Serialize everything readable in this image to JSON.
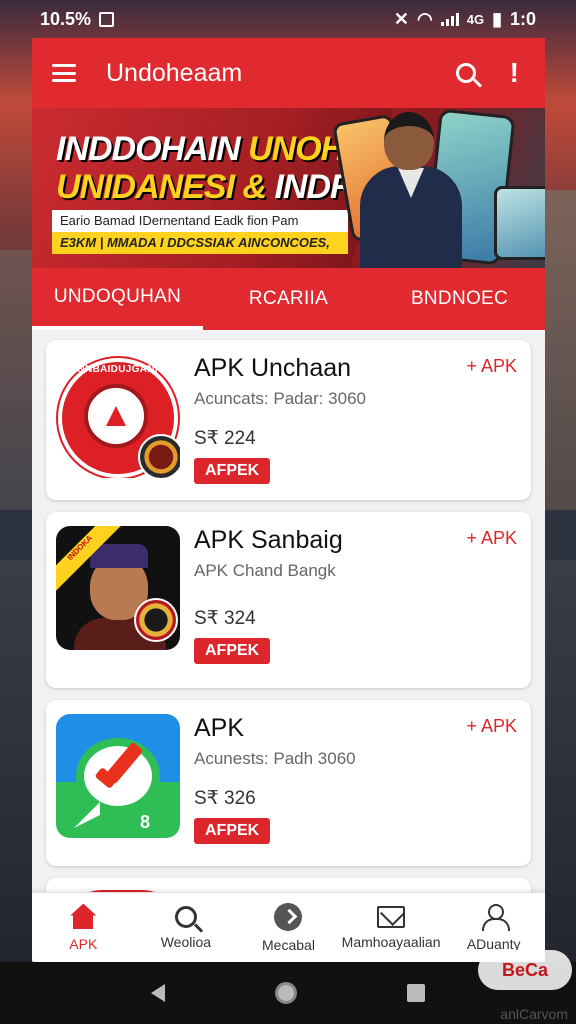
{
  "status_bar": {
    "left_text": "10.5%",
    "time": "1:0",
    "network_text": "4G"
  },
  "app_bar": {
    "title": "Undoheaam"
  },
  "banner": {
    "line1_white": "INDDOHAIN ",
    "line1_yellow": "UNOHMAM",
    "line2_yellow": "UNIDANESI & ",
    "line2_white": "INDRASII",
    "strip1": "Eario Bamad IDernentand Eadk fion Pam",
    "strip2": "E3KM | MMADA I DDCSSIAK AINCONCOES,"
  },
  "tabs": [
    {
      "label": "UNDOQUHAN",
      "active": true
    },
    {
      "label": "RCARIIA",
      "active": false
    },
    {
      "label": "BNDNOEC",
      "active": false
    }
  ],
  "apps": [
    {
      "name": "APK Unchaan",
      "sub": "Acuncats: Padar: 3060",
      "price": "S₹ 224",
      "tag": "AFPEK",
      "add": "+ APK",
      "logo_text": "DNNBAIDUJGANNIR",
      "icon": "red-emblem-icon"
    },
    {
      "name": "APK Sanbaig",
      "sub": "APK Chand Bangk",
      "price": "S₹ 324",
      "tag": "AFPEK",
      "add": "+ APK",
      "ribbon_text": "INDOKA",
      "icon": "portrait-icon"
    },
    {
      "name": "APK",
      "sub": "Acunests: Padh 3060",
      "price": "S₹ 326",
      "tag": "AFPEK",
      "add": "+ APK",
      "badge_number": "8",
      "icon": "chat-check-icon"
    }
  ],
  "bottom_nav": [
    {
      "label": "APK",
      "icon": "home-icon",
      "active": true
    },
    {
      "label": "Weolioa",
      "icon": "search-icon",
      "active": false
    },
    {
      "label": "Mecabal",
      "icon": "arrow-circle-icon",
      "active": false
    },
    {
      "label": "Mamhoayaalian",
      "icon": "mail-icon",
      "active": false
    },
    {
      "label": "ADuanty",
      "icon": "user-icon",
      "active": false
    }
  ],
  "watermark": {
    "text": "BeCa",
    "subtext": "anlCarvom"
  },
  "colors": {
    "primary_red": "#e02a2f",
    "tag_red": "#dd262c",
    "banner_yellow": "#ffd21f"
  }
}
